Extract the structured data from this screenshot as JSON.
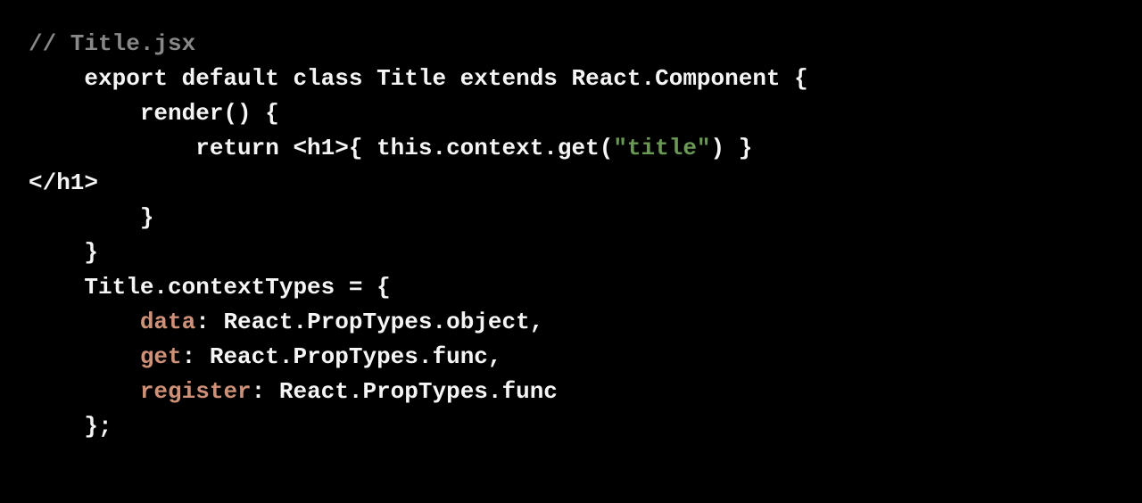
{
  "code": {
    "lines": [
      {
        "segments": [
          {
            "text": "// Title.jsx",
            "class": "comment"
          }
        ]
      },
      {
        "segments": [
          {
            "text": "    export default class Title extends React.Component {",
            "class": "default-text"
          }
        ]
      },
      {
        "segments": [
          {
            "text": "        render() {",
            "class": "default-text"
          }
        ]
      },
      {
        "segments": [
          {
            "text": "            return <h1>{ this.context.get(",
            "class": "default-text"
          },
          {
            "text": "\"title\"",
            "class": "string"
          },
          {
            "text": ") }",
            "class": "default-text"
          }
        ]
      },
      {
        "segments": [
          {
            "text": "</h1>",
            "class": "default-text"
          }
        ]
      },
      {
        "segments": [
          {
            "text": "        }",
            "class": "default-text"
          }
        ]
      },
      {
        "segments": [
          {
            "text": "    }",
            "class": "default-text"
          }
        ]
      },
      {
        "segments": [
          {
            "text": "    Title.contextTypes = {",
            "class": "default-text"
          }
        ]
      },
      {
        "segments": [
          {
            "text": "        ",
            "class": "default-text"
          },
          {
            "text": "data",
            "class": "property"
          },
          {
            "text": ": React.PropTypes.object,",
            "class": "default-text"
          }
        ]
      },
      {
        "segments": [
          {
            "text": "        ",
            "class": "default-text"
          },
          {
            "text": "get",
            "class": "property"
          },
          {
            "text": ": React.PropTypes.func,",
            "class": "default-text"
          }
        ]
      },
      {
        "segments": [
          {
            "text": "        ",
            "class": "default-text"
          },
          {
            "text": "register",
            "class": "property"
          },
          {
            "text": ": React.PropTypes.func",
            "class": "default-text"
          }
        ]
      },
      {
        "segments": [
          {
            "text": "    };",
            "class": "default-text"
          }
        ]
      }
    ]
  }
}
